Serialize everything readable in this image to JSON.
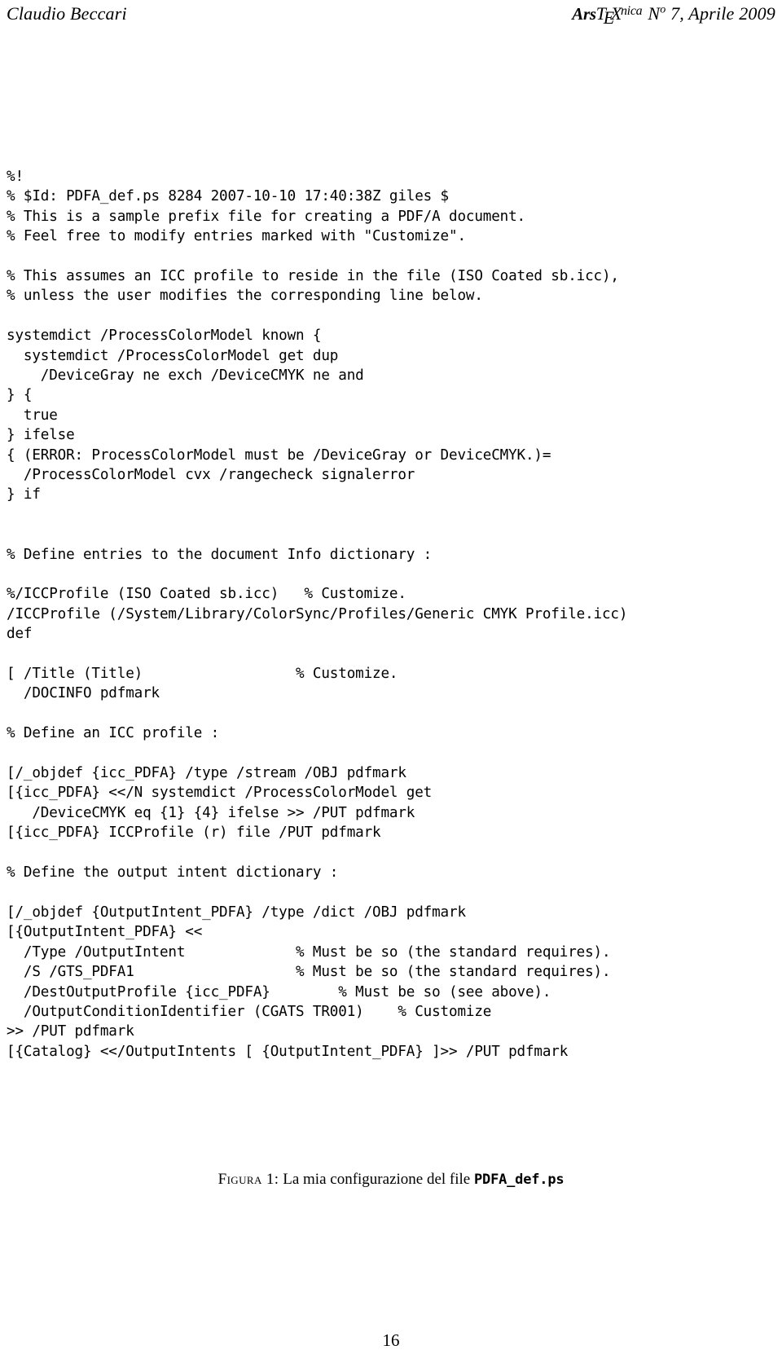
{
  "header": {
    "author": "Claudio Beccari",
    "journal": {
      "ars": "Ars",
      "t": "T",
      "e": "E",
      "x": "X",
      "nica": "nica"
    },
    "issue_prefix": "N",
    "issue_sup": "o",
    "issue_rest": " 7, Aprile 2009"
  },
  "listing": {
    "lines": [
      "%!",
      "% $Id: PDFA_def.ps 8284 2007-10-10 17:40:38Z giles $",
      "% This is a sample prefix file for creating a PDF/A document.",
      "% Feel free to modify entries marked with \"Customize\".",
      "",
      "% This assumes an ICC profile to reside in the file (ISO Coated sb.icc),",
      "% unless the user modifies the corresponding line below.",
      "",
      "systemdict /ProcessColorModel known {",
      "  systemdict /ProcessColorModel get dup",
      "    /DeviceGray ne exch /DeviceCMYK ne and",
      "} {",
      "  true",
      "} ifelse",
      "{ (ERROR: ProcessColorModel must be /DeviceGray or DeviceCMYK.)=",
      "  /ProcessColorModel cvx /rangecheck signalerror",
      "} if",
      "",
      "",
      "% Define entries to the document Info dictionary :",
      "",
      "%/ICCProfile (ISO Coated sb.icc)   % Customize.",
      "/ICCProfile (/System/Library/ColorSync/Profiles/Generic CMYK Profile.icc)",
      "def",
      "",
      "[ /Title (Title)                  % Customize.",
      "  /DOCINFO pdfmark",
      "",
      "% Define an ICC profile :",
      "",
      "[/_objdef {icc_PDFA} /type /stream /OBJ pdfmark",
      "[{icc_PDFA} <</N systemdict /ProcessColorModel get",
      "   /DeviceCMYK eq {1} {4} ifelse >> /PUT pdfmark",
      "[{icc_PDFA} ICCProfile (r) file /PUT pdfmark",
      "",
      "% Define the output intent dictionary :",
      "",
      "[/_objdef {OutputIntent_PDFA} /type /dict /OBJ pdfmark",
      "[{OutputIntent_PDFA} <<",
      "  /Type /OutputIntent             % Must be so (the standard requires).",
      "  /S /GTS_PDFA1                   % Must be so (the standard requires).",
      "  /DestOutputProfile {icc_PDFA}        % Must be so (see above).",
      "  /OutputConditionIdentifier (CGATS TR001)    % Customize",
      ">> /PUT pdfmark",
      "[{Catalog} <</OutputIntents [ {OutputIntent_PDFA} ]>> /PUT pdfmark"
    ]
  },
  "caption": {
    "label": "Figura 1:",
    "text_before": " La mia configurazione del file ",
    "filename": "PDFA_def.ps"
  },
  "footer": {
    "page_number": "16"
  }
}
